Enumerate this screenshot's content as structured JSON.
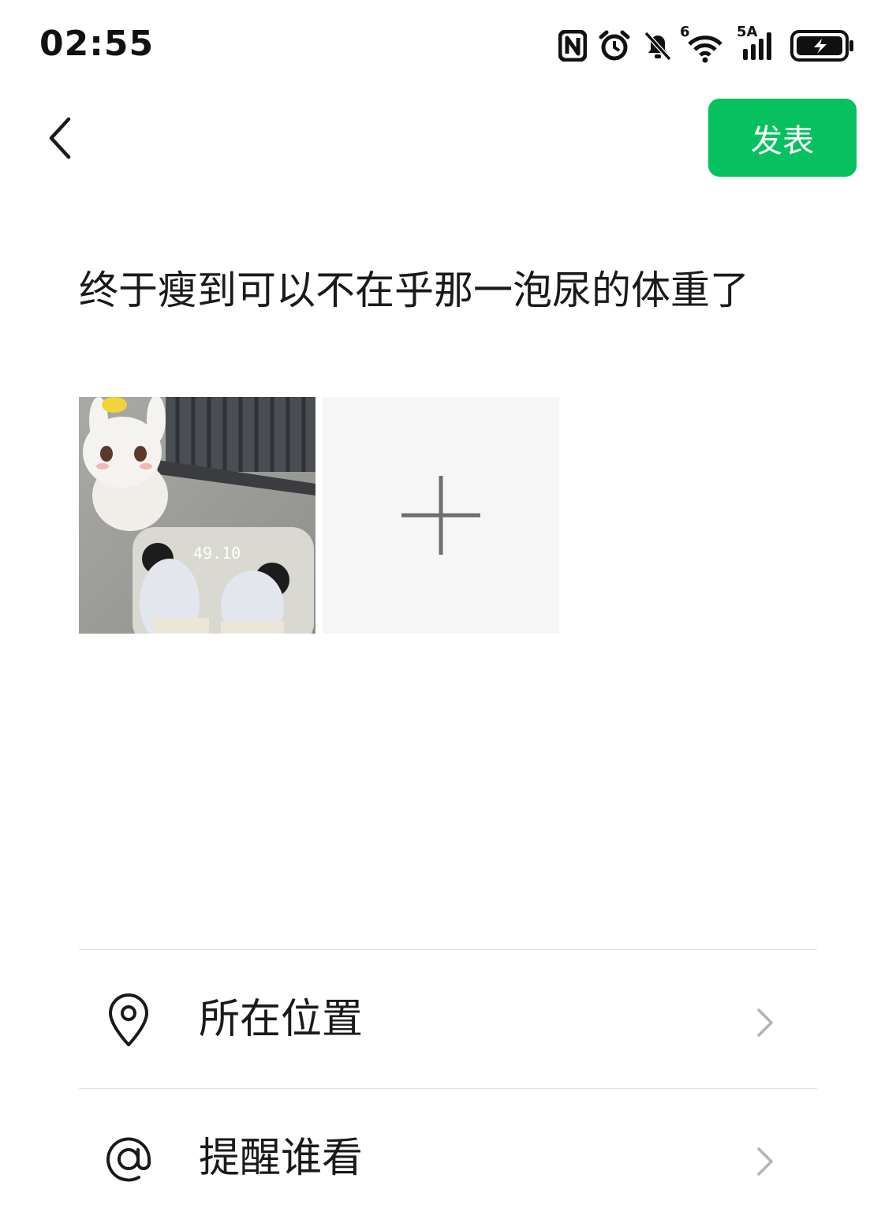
{
  "status_bar": {
    "time": "02:55",
    "icons": [
      "nfc-icon",
      "alarm-icon",
      "mute-bell-icon",
      "wifi-6-icon",
      "5a-signal-icon",
      "battery-charging-icon"
    ],
    "wifi_badge": "6",
    "signal_badge": "5A"
  },
  "header": {
    "back_icon": "back-chevron-icon",
    "publish_label": "发表",
    "accent_color": "#07c160"
  },
  "post": {
    "text": "终于瘦到可以不在乎那一泡尿的体重了",
    "photos": [
      {
        "description_icon": "photo-thumbnail",
        "scale_reading": "49.10"
      }
    ],
    "add_icon": "plus-icon"
  },
  "settings": [
    {
      "icon": "location-pin-icon",
      "label": "所在位置"
    },
    {
      "icon": "at-sign-icon",
      "label": "提醒谁看"
    }
  ]
}
